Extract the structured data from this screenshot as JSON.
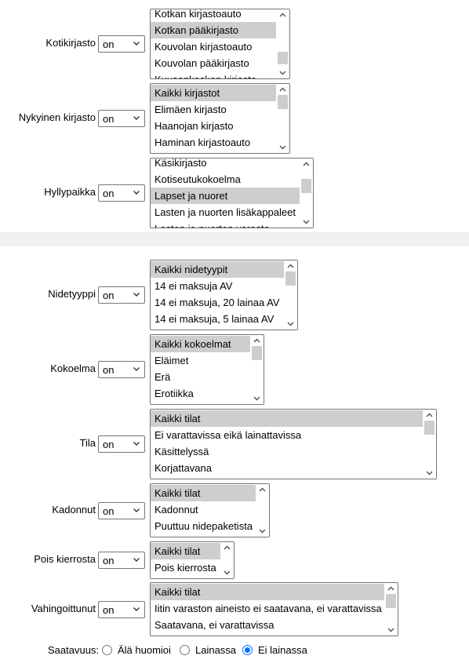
{
  "filters": [
    {
      "label": "Kotikirjasto",
      "op": "on",
      "items": [
        "Kotkan kirjastoauto",
        "Kotkan pääkirjasto",
        "Kouvolan kirjastoauto",
        "Kouvolan pääkirjasto",
        "Kuusankosken kirjasto"
      ],
      "selected": [
        1
      ]
    },
    {
      "label": "Nykyinen kirjasto",
      "op": "on",
      "items": [
        "Kaikki kirjastot",
        "Elimäen kirjasto",
        "Haanojan kirjasto",
        "Haminan kirjastoauto"
      ],
      "selected": [
        0
      ]
    },
    {
      "label": "Hyllypaikka",
      "op": "on",
      "items": [
        "Käsikirjasto",
        "Kotiseutukokoelma",
        "Lapset ja nuoret",
        "Lasten ja nuorten lisäkappaleet",
        "Lasten ja nuorten varasto"
      ],
      "selected": [
        2
      ]
    },
    {
      "label": "Nidetyyppi",
      "op": "on",
      "items": [
        "Kaikki nidetyypit",
        "14 ei maksuja AV",
        "14 ei maksuja, 20 lainaa AV",
        "14 ei maksuja, 5 lainaa AV"
      ],
      "selected": [
        0
      ]
    },
    {
      "label": "Kokoelma",
      "op": "on",
      "items": [
        "Kaikki kokoelmat",
        "Eläimet",
        "Erä",
        "Erotiikka"
      ],
      "selected": [
        0
      ]
    },
    {
      "label": "Tila",
      "op": "on",
      "items": [
        "Kaikki tilat",
        "Ei varattavissa eikä lainattavissa",
        "Käsittelyssä",
        "Korjattavana"
      ],
      "selected": [
        0
      ]
    },
    {
      "label": "Kadonnut",
      "op": "on",
      "items": [
        "Kaikki tilat",
        "Kadonnut",
        "Puuttuu nidepaketista"
      ],
      "selected": [
        0
      ]
    },
    {
      "label": "Pois kierrosta",
      "op": "on",
      "items": [
        "Kaikki tilat",
        "Pois kierrosta"
      ],
      "selected": [
        0
      ]
    },
    {
      "label": "Vahingoittunut",
      "op": "on",
      "items": [
        "Kaikki tilat",
        "Iitin varaston aineisto ei saatavana, ei varattavissa",
        "Saatavana, ei varattavissa"
      ],
      "selected": [
        0
      ]
    }
  ],
  "availability": {
    "label": "Saatavuus:",
    "options": [
      "Älä huomioi",
      "Lainassa",
      "Ei lainassa"
    ],
    "selected": 2
  }
}
